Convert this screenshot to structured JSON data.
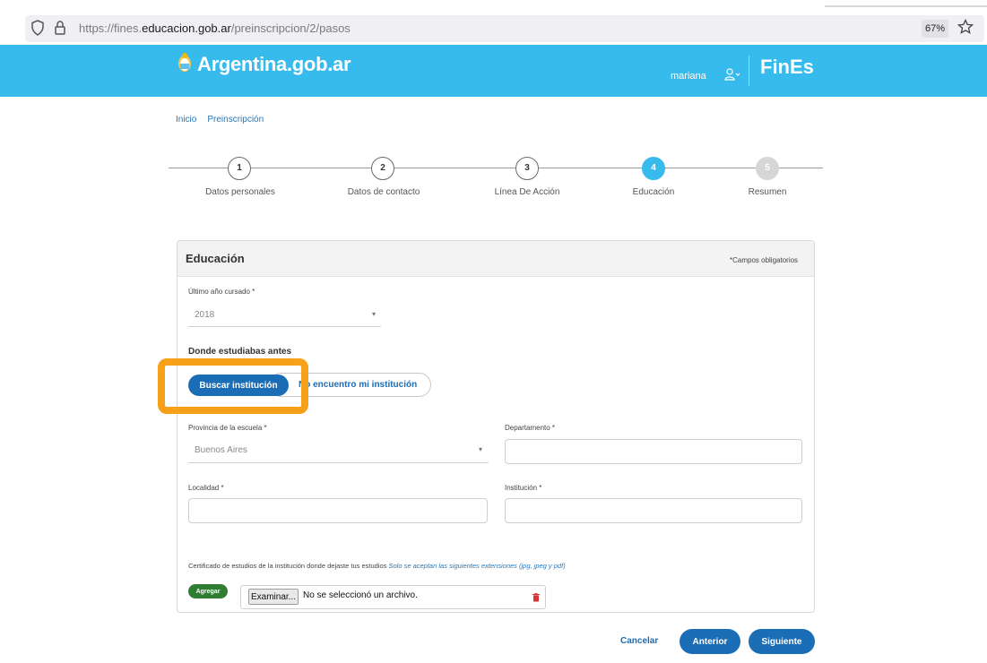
{
  "browser": {
    "url_prefix": "https://fines.",
    "url_domain": "educacion.gob.ar",
    "url_path": "/preinscripcion/2/pasos",
    "zoom": "67%"
  },
  "header": {
    "brand": "Argentina.gob.ar",
    "user": "mariana",
    "app_logo": "FinEs"
  },
  "breadcrumb": [
    "Inicio",
    "Preinscripción"
  ],
  "stepper": {
    "steps": [
      {
        "number": "1",
        "label": "Datos personales",
        "state": "done"
      },
      {
        "number": "2",
        "label": "Datos de contacto",
        "state": "done"
      },
      {
        "number": "3",
        "label": "Línea De Acción",
        "state": "done"
      },
      {
        "number": "4",
        "label": "Educación",
        "state": "active"
      },
      {
        "number": "5",
        "label": "Resumen",
        "state": "pending"
      }
    ]
  },
  "form": {
    "title": "Educación",
    "required_note": "*Campos obligatorios",
    "last_year": {
      "label": "Último año cursado *",
      "value": "2018"
    },
    "section_title": "Donde estudiabas antes",
    "search_button": "Buscar institución",
    "not_found_button": "No encuentro mi institución",
    "province": {
      "label": "Provincia de la escuela *",
      "value": "Buenos Aires"
    },
    "department": {
      "label": "Departamento *",
      "value": ""
    },
    "locality": {
      "label": "Localidad *",
      "value": ""
    },
    "institution": {
      "label": "Institución *",
      "value": ""
    },
    "certificate": {
      "label": "Certificado de estudios de la institución donde dejaste tus estudios",
      "note": "Solo se aceptan las siguientes extensiones (jpg, jpeg y pdf)",
      "add_button": "Agregar",
      "browse_button": "Examinar...",
      "file_status": "No se seleccionó un archivo."
    }
  },
  "actions": {
    "cancel": "Cancelar",
    "previous": "Anterior",
    "next": "Siguiente"
  },
  "colors": {
    "header": "#37bbed",
    "primary": "#1b6db5",
    "highlight": "#f7a11a",
    "add_button": "#2e7d32"
  }
}
